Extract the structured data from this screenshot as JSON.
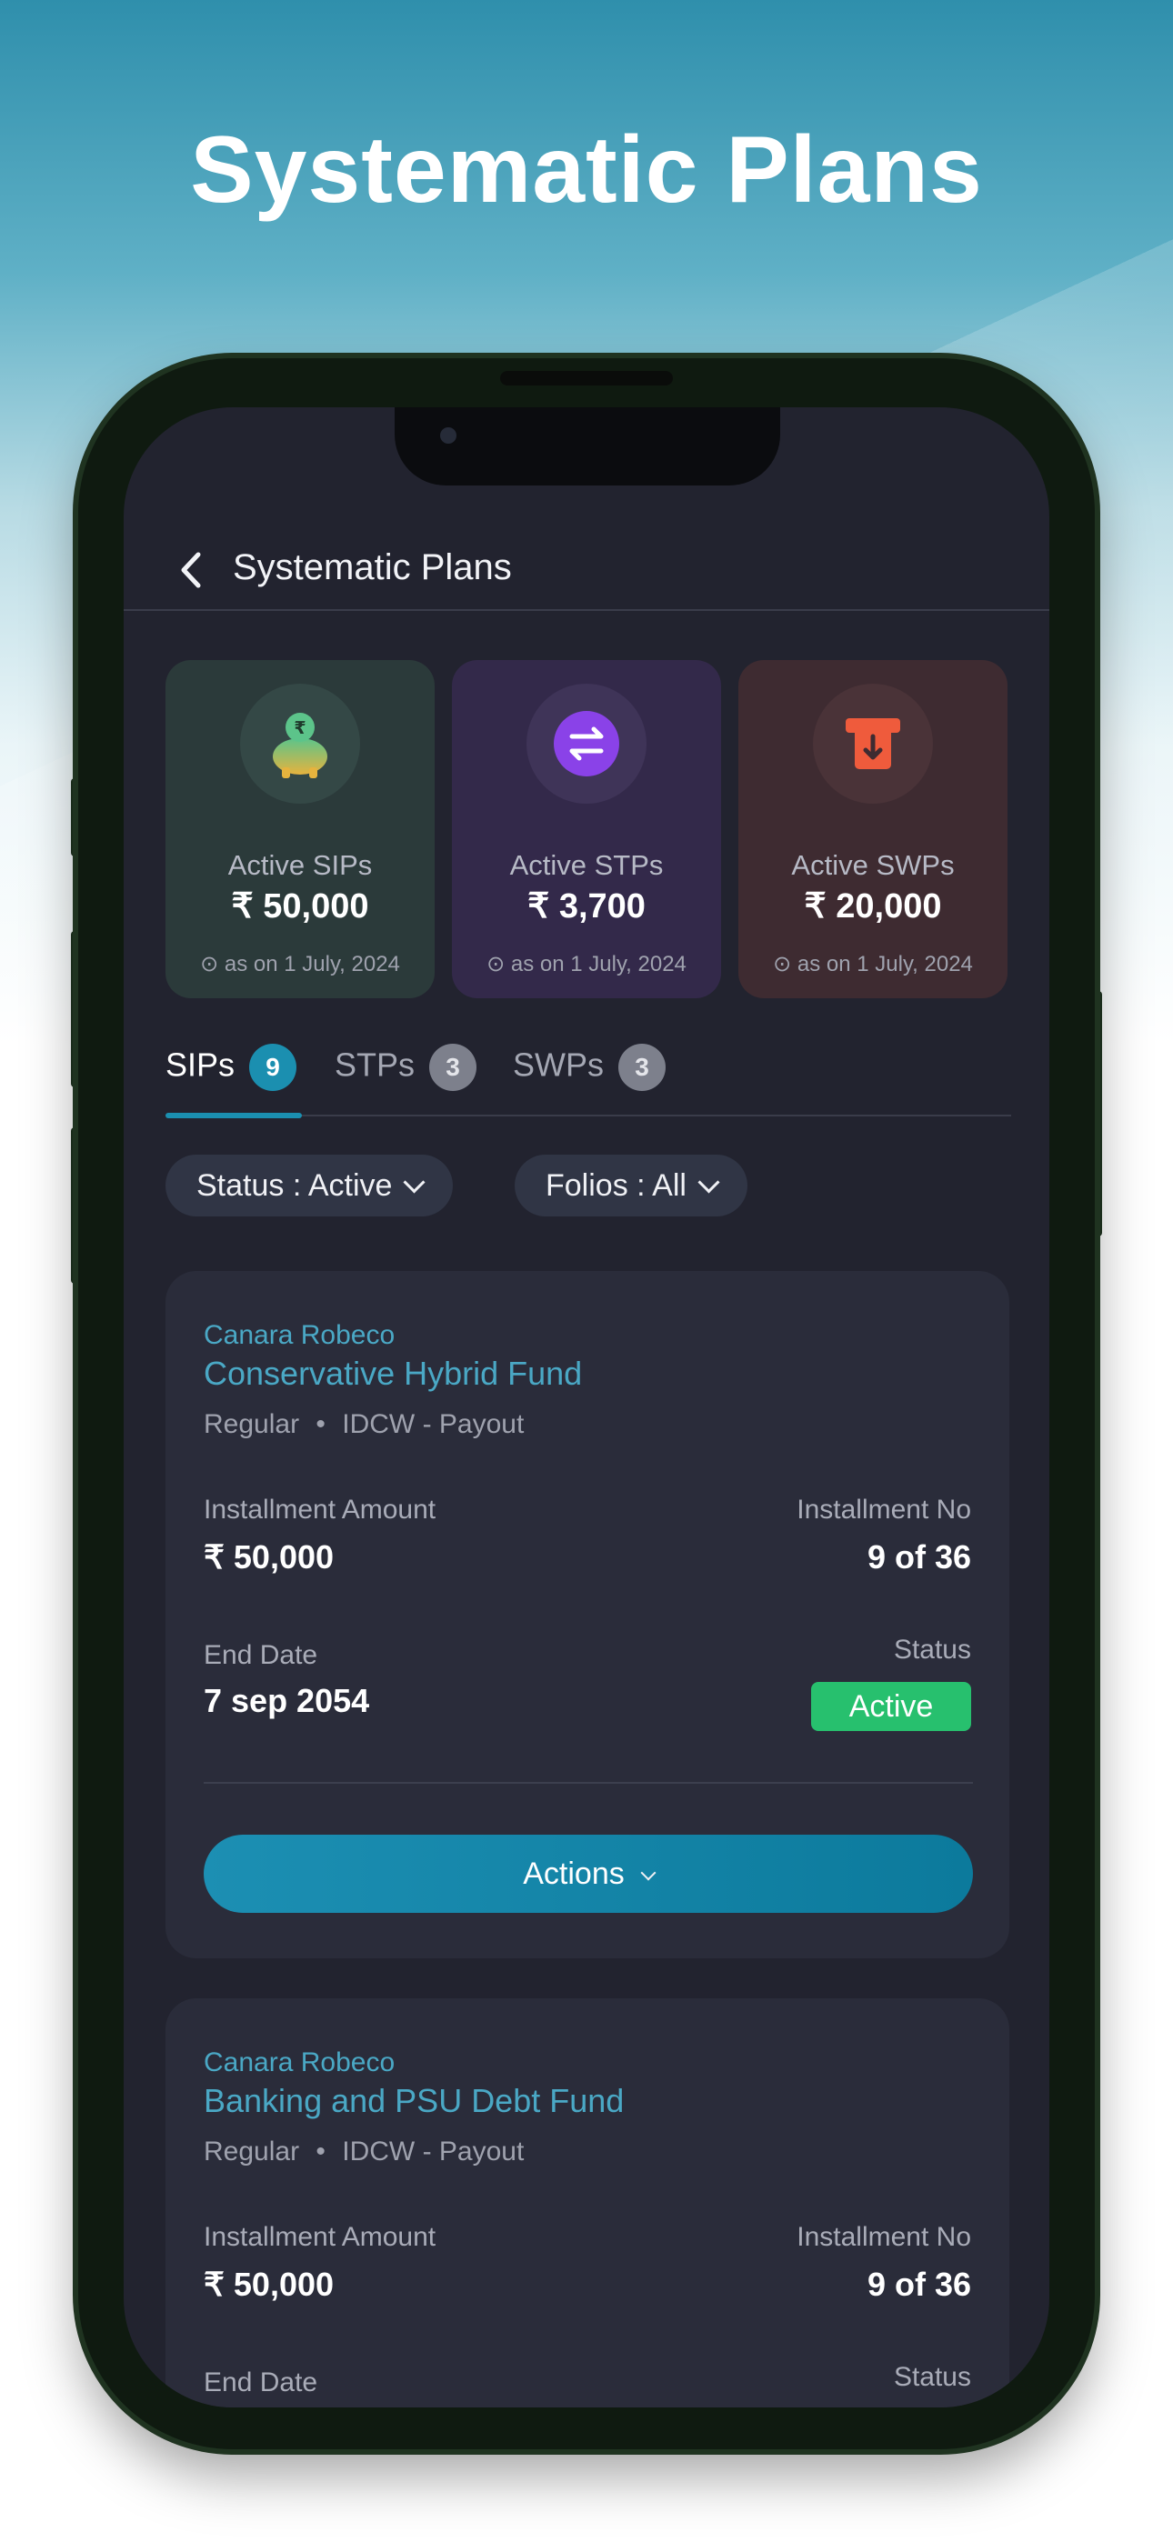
{
  "headline": "Systematic Plans",
  "header": {
    "title": "Systematic Plans"
  },
  "summary_cards": [
    {
      "label": "Active SIPs",
      "amount": "₹ 50,000",
      "as_of": "as on 1 July, 2024"
    },
    {
      "label": "Active STPs",
      "amount": "₹ 3,700",
      "as_of": "as on 1 July, 2024"
    },
    {
      "label": "Active SWPs",
      "amount": "₹ 20,000",
      "as_of": "as on 1 July, 2024"
    }
  ],
  "tabs": [
    {
      "label": "SIPs",
      "count": "9",
      "active": true
    },
    {
      "label": "STPs",
      "count": "3",
      "active": false
    },
    {
      "label": "SWPs",
      "count": "3",
      "active": false
    }
  ],
  "filters": {
    "status": "Status : Active",
    "folios": "Folios : All"
  },
  "plans": [
    {
      "amc": "Canara Robeco",
      "fund": "Conservative Hybrid Fund",
      "plan_type": "Regular",
      "option": "IDCW - Payout",
      "installment_amount_label": "Installment Amount",
      "installment_amount": "₹ 50,000",
      "installment_no_label": "Installment No",
      "installment_no": "9 of 36",
      "end_date_label": "End Date",
      "end_date": "7 sep 2054",
      "status_label": "Status",
      "status": "Active",
      "actions_label": "Actions"
    },
    {
      "amc": "Canara Robeco",
      "fund": "Banking and PSU Debt Fund",
      "plan_type": "Regular",
      "option": "IDCW - Payout",
      "installment_amount_label": "Installment Amount",
      "installment_amount": "₹ 50,000",
      "installment_no_label": "Installment No",
      "installment_no": "9 of 36",
      "end_date_label": "End Date",
      "status_label": "Status"
    }
  ],
  "colors": {
    "accent": "#1b8fb0",
    "fund_link": "#4aa8c5",
    "status_active": "#27c06e",
    "screen_bg": "#22232f",
    "card_sip": "#2b3a3a",
    "card_stp": "#33294a",
    "card_swp": "#3e2b31"
  },
  "icons": {
    "back": "chevron-left-icon",
    "sip": "piggy-bank-rupee-icon",
    "stp": "swap-arrows-icon",
    "swp": "atm-withdraw-icon",
    "as_of": "clock-icon",
    "dropdown": "chevron-down-icon"
  }
}
